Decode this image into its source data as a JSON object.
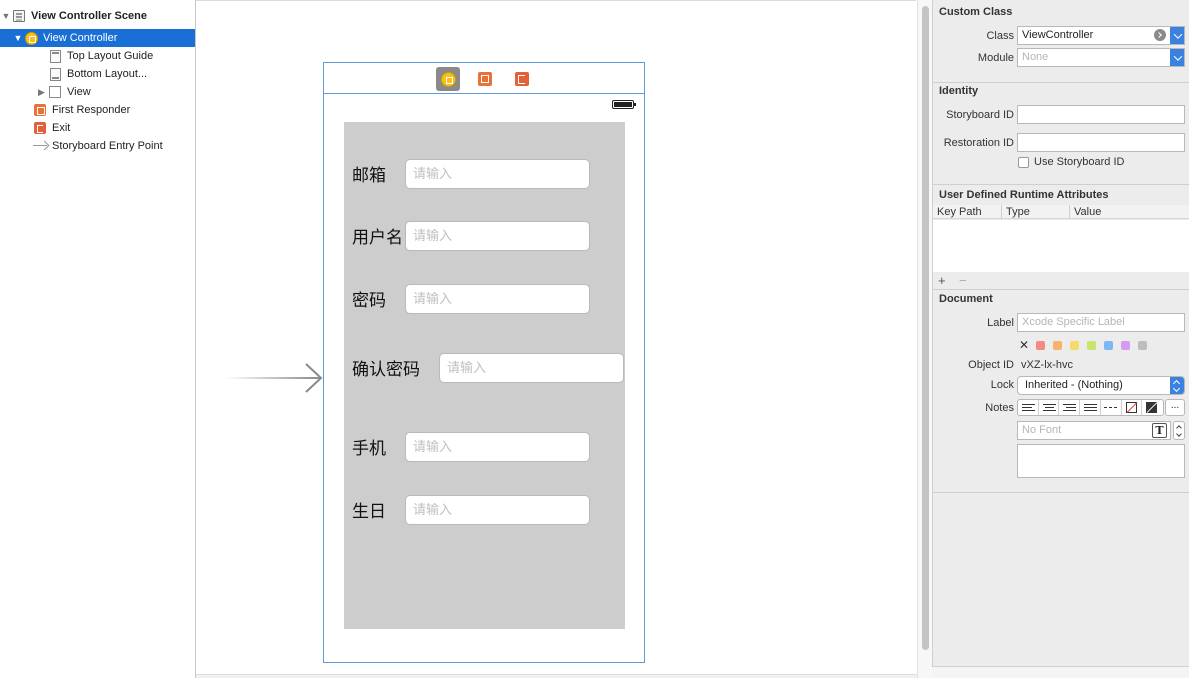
{
  "outline": {
    "items": [
      {
        "label": "View Controller Scene",
        "icon": "scene-icon"
      },
      {
        "label": "View Controller",
        "icon": "view-controller-icon"
      },
      {
        "label": "Top Layout Guide",
        "icon": "top-layout-guide-icon"
      },
      {
        "label": "Bottom Layout...",
        "icon": "bottom-layout-guide-icon"
      },
      {
        "label": "View",
        "icon": "view-icon"
      },
      {
        "label": "First Responder",
        "icon": "first-responder-icon"
      },
      {
        "label": "Exit",
        "icon": "exit-icon"
      },
      {
        "label": "Storyboard Entry Point",
        "icon": "entry-arrow-icon"
      }
    ],
    "selected_index": 1
  },
  "scene": {
    "dock_icons": [
      "view-controller-icon",
      "first-responder-icon",
      "exit-icon"
    ],
    "form_background": "#cdcdcd",
    "fields": [
      {
        "label": "邮箱",
        "placeholder": "请输入"
      },
      {
        "label": "用户名",
        "placeholder": "请输入"
      },
      {
        "label": "密码",
        "placeholder": "请输入"
      },
      {
        "label": "确认密码",
        "placeholder": "请输入"
      },
      {
        "label": "手机",
        "placeholder": "请输入"
      },
      {
        "label": "生日",
        "placeholder": "请输入"
      }
    ]
  },
  "inspector": {
    "custom_class": {
      "title": "Custom Class",
      "class_label": "Class",
      "class_value": "ViewController",
      "module_label": "Module",
      "module_placeholder": "None"
    },
    "identity": {
      "title": "Identity",
      "storyboard_id_label": "Storyboard ID",
      "storyboard_id_value": "",
      "restoration_id_label": "Restoration ID",
      "restoration_id_value": "",
      "use_storyboard_id_label": "Use Storyboard ID",
      "use_storyboard_id_checked": false
    },
    "runtime_attributes": {
      "title": "User Defined Runtime Attributes",
      "columns": [
        "Key Path",
        "Type",
        "Value"
      ],
      "add_label": "+",
      "remove_label": "−"
    },
    "document": {
      "title": "Document",
      "label_label": "Label",
      "label_placeholder": "Xcode Specific Label",
      "clear_label": "✕",
      "label_colors": [
        "#f28b82",
        "#f7b26b",
        "#f3dc6a",
        "#c9e46b",
        "#7fb6f5",
        "#d59cf2",
        "#bdbdbd"
      ],
      "object_id_label": "Object ID",
      "object_id_value": "vXZ-lx-hvc",
      "lock_label": "Lock",
      "lock_value": "Inherited - (Nothing)",
      "notes_label": "Notes",
      "more_label": "...",
      "font_placeholder": "No Font",
      "font_button_label": "T"
    }
  },
  "colors": {
    "selection": "#1a6fd6",
    "scene_border": "#5f9bd9",
    "accent_blue": "#3b82e0"
  }
}
